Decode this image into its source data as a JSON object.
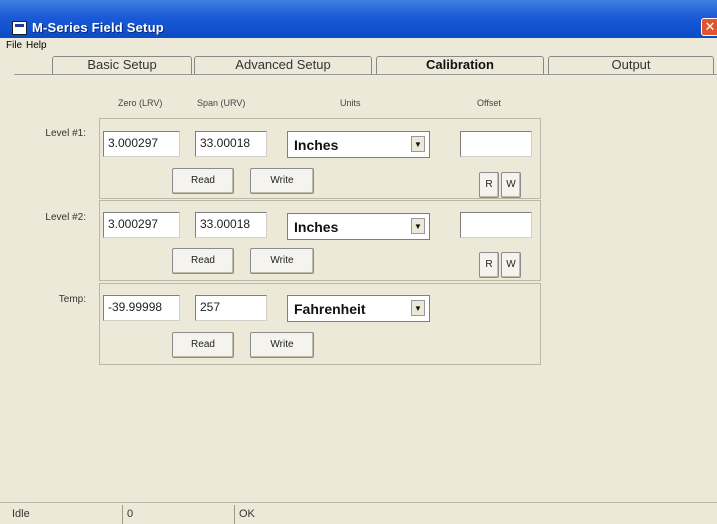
{
  "window": {
    "title": "M-Series Field Setup",
    "close": "✕"
  },
  "menu": {
    "file": "File",
    "help": "Help"
  },
  "tabs": [
    {
      "label": "Basic Setup"
    },
    {
      "label": "Advanced Setup"
    },
    {
      "label": "Calibration",
      "active": true
    },
    {
      "label": "Output"
    }
  ],
  "columns": {
    "zero": "Zero (LRV)",
    "span": "Span (URV)",
    "units": "Units",
    "offset": "Offset"
  },
  "level1": {
    "label": "Level #1:",
    "zero": "3.000297",
    "span": "33.00018",
    "units": "Inches",
    "offset": "",
    "read": "Read",
    "write": "Write",
    "r": "R",
    "w": "W"
  },
  "level2": {
    "label": "Level #2:",
    "zero": "3.000297",
    "span": "33.00018",
    "units": "Inches",
    "offset": "",
    "read": "Read",
    "write": "Write",
    "r": "R",
    "w": "W"
  },
  "temp": {
    "label": "Temp:",
    "zero": "-39.99998",
    "span": "257",
    "units": "Fahrenheit",
    "read": "Read",
    "write": "Write"
  },
  "status": {
    "state": "Idle",
    "count": "0",
    "message": "OK"
  }
}
